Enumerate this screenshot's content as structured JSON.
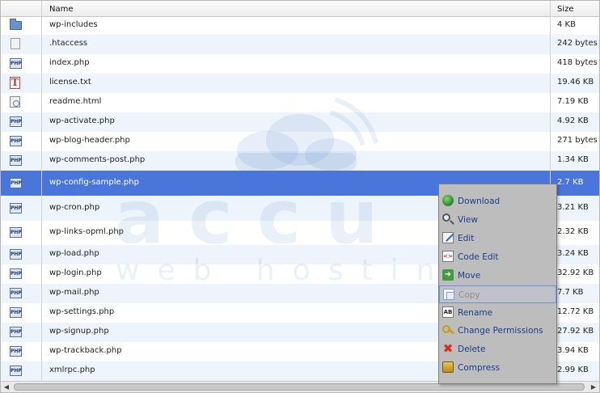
{
  "columns": {
    "name": "Name",
    "size": "Size"
  },
  "files": [
    {
      "icon": "folder-icon",
      "name": "wp-includes",
      "size": "4 KB"
    },
    {
      "icon": "file-icon",
      "name": ".htaccess",
      "size": "242 bytes"
    },
    {
      "icon": "php-file-icon",
      "name": "index.php",
      "size": "418 bytes"
    },
    {
      "icon": "text-file-icon",
      "name": "license.txt",
      "size": "19.46 KB"
    },
    {
      "icon": "html-file-icon",
      "name": "readme.html",
      "size": "7.19 KB"
    },
    {
      "icon": "php-file-icon",
      "name": "wp-activate.php",
      "size": "4.92 KB"
    },
    {
      "icon": "php-file-icon",
      "name": "wp-blog-header.php",
      "size": "271 bytes"
    },
    {
      "icon": "php-file-icon",
      "name": "wp-comments-post.php",
      "size": "1.34 KB"
    },
    {
      "icon": "php-file-icon",
      "name": "wp-config-sample.php",
      "size": "2.7 KB",
      "selected": true
    },
    {
      "icon": "php-file-icon",
      "name": "wp-cron.php",
      "size": "3.21 KB"
    },
    {
      "icon": "php-file-icon",
      "name": "wp-links-opml.php",
      "size": "2.32 KB"
    },
    {
      "icon": "php-file-icon",
      "name": "wp-load.php",
      "size": "3.24 KB"
    },
    {
      "icon": "php-file-icon",
      "name": "wp-login.php",
      "size": "32.92 KB"
    },
    {
      "icon": "php-file-icon",
      "name": "wp-mail.php",
      "size": "7.7 KB"
    },
    {
      "icon": "php-file-icon",
      "name": "wp-settings.php",
      "size": "12.72 KB"
    },
    {
      "icon": "php-file-icon",
      "name": "wp-signup.php",
      "size": "27.92 KB"
    },
    {
      "icon": "php-file-icon",
      "name": "wp-trackback.php",
      "size": "3.94 KB"
    },
    {
      "icon": "php-file-icon",
      "name": "xmlrpc.php",
      "size": "2.99 KB"
    }
  ],
  "context_menu": {
    "items": [
      {
        "label": "Download",
        "icon": "globe-download-icon",
        "enabled": true
      },
      {
        "label": "View",
        "icon": "magnifier-icon",
        "enabled": true
      },
      {
        "label": "Edit",
        "icon": "pencil-icon",
        "enabled": true
      },
      {
        "label": "Code Edit",
        "icon": "code-icon",
        "enabled": true
      },
      {
        "label": "Move",
        "icon": "arrow-right-icon",
        "enabled": true
      },
      {
        "label": "Copy",
        "icon": "copy-icon",
        "enabled": false
      },
      {
        "label": "Rename",
        "icon": "rename-icon",
        "enabled": true
      },
      {
        "label": "Change Permissions",
        "icon": "key-icon",
        "enabled": true
      },
      {
        "label": "Delete",
        "icon": "red-x-icon",
        "enabled": true
      },
      {
        "label": "Compress",
        "icon": "archive-box-icon",
        "enabled": true
      }
    ]
  },
  "watermark": {
    "brand": "accu",
    "tagline": "web hosting"
  },
  "colors": {
    "selection": "#4a76db",
    "menu_bg": "#bdbdbd",
    "menu_text": "#1d3d8a",
    "row_alt": "#eef4fb"
  }
}
